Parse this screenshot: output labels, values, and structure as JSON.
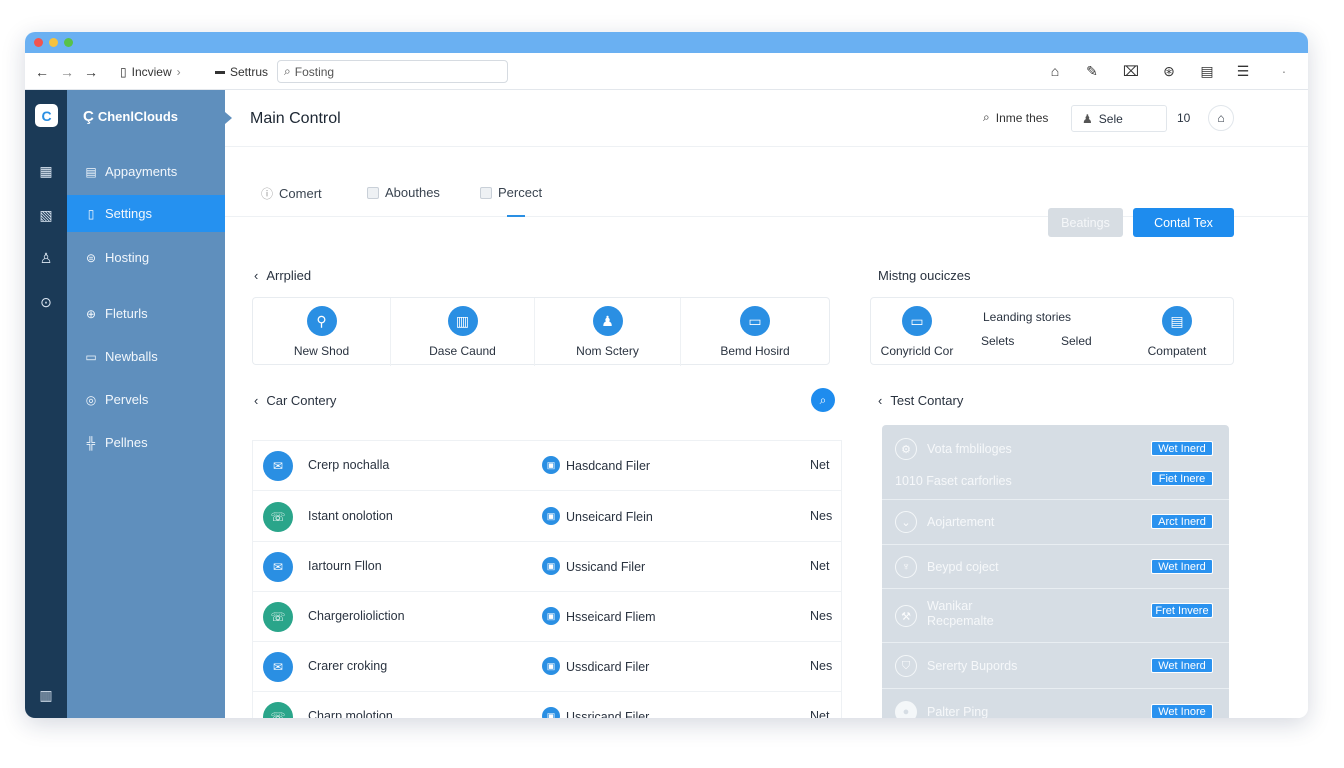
{
  "browser": {
    "tab1": "Incview",
    "tab2": "Settrus",
    "address": "Fosting"
  },
  "sidebar": {
    "brand": "ChenlClouds",
    "items": [
      {
        "label": "Appayments",
        "icon": "calendar-icon"
      },
      {
        "label": "Settings",
        "icon": "doc-icon"
      },
      {
        "label": "Hosting",
        "icon": "gear-icon"
      },
      {
        "label": "Fleturls",
        "icon": "globe-icon"
      },
      {
        "label": "Newballs",
        "icon": "mail-icon"
      },
      {
        "label": "Pervels",
        "icon": "circle-icon"
      },
      {
        "label": "Pellnes",
        "icon": "grid-icon"
      }
    ]
  },
  "header": {
    "title": "Main Control",
    "search_label": "Inme thes",
    "user_label": "Sele",
    "count": "10"
  },
  "tabs": [
    "Comert",
    "Abouthes",
    "Percect"
  ],
  "buttons": {
    "secondary": "Beatings",
    "primary": "Contal Tex"
  },
  "section1": {
    "title": "Arrplied",
    "cards": [
      "New Shod",
      "Dase Caund",
      "Nom Sctery",
      "Bemd Hosird"
    ]
  },
  "section2": {
    "title": "Mistng ouciczes",
    "cards": [
      {
        "label": "Conyricld Cor"
      },
      {
        "label": "Leanding stories"
      },
      {
        "label": "Selets"
      },
      {
        "label": "Seled"
      },
      {
        "label": "Compatent"
      }
    ]
  },
  "section3": {
    "title": "Car Contery",
    "rows": [
      {
        "name": "Crerp nochalla",
        "file": "Hasdcand Filer",
        "status": "Net"
      },
      {
        "name": "Istant onolotion",
        "file": "Unseicard Flein",
        "status": "Nes"
      },
      {
        "name": "Iartourn Fllon",
        "file": "Ussicand Filer",
        "status": "Net"
      },
      {
        "name": "Chargerolioliction",
        "file": "Hsseicard Fliem",
        "status": "Nes"
      },
      {
        "name": "Crarer croking",
        "file": "Ussdicard Filer",
        "status": "Nes"
      },
      {
        "name": "Charp molotion",
        "file": "Ussricand Filer",
        "status": "Net"
      }
    ]
  },
  "section4": {
    "title": "Test Contary",
    "rows": [
      {
        "title": "Vota fmbliloges",
        "badge": "Wet Inerd"
      },
      {
        "title": "1010 Faset carforlies",
        "badge": "Fiet Inere"
      },
      {
        "title": "Aojartement",
        "badge": "Arct Inerd"
      },
      {
        "title": "Beypd coject",
        "badge": "Wet Inerd"
      },
      {
        "title": "Wanikar Recpemalte",
        "badge": "Fret Invere"
      },
      {
        "title": "Sererty Bupords",
        "badge": "Wet Inerd"
      },
      {
        "title": "Palter Ping",
        "badge": "Wet Inore"
      }
    ]
  }
}
